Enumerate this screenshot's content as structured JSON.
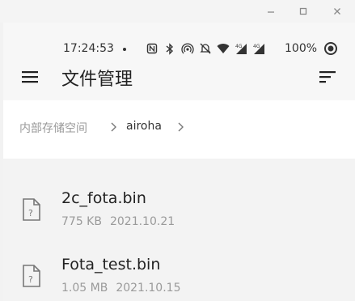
{
  "window": {
    "controls": [
      "minimize",
      "maximize",
      "close"
    ]
  },
  "status_bar": {
    "time": "17:24:53",
    "battery": "100%",
    "icons": [
      "nfc-icon",
      "bluetooth-icon",
      "hotspot-icon",
      "mute-icon",
      "wifi-icon",
      "signal-4g-icon",
      "signal-4g-2-icon",
      "ring-icon"
    ]
  },
  "app_bar": {
    "title": "文件管理"
  },
  "breadcrumb": {
    "parent": "内部存储空间",
    "current": "airoha"
  },
  "files": [
    {
      "name": "2c_fota.bin",
      "size": "775 KB",
      "date": "2021.10.21"
    },
    {
      "name": "Fota_test.bin",
      "size": "1.05 MB",
      "date": "2021.10.15"
    }
  ]
}
